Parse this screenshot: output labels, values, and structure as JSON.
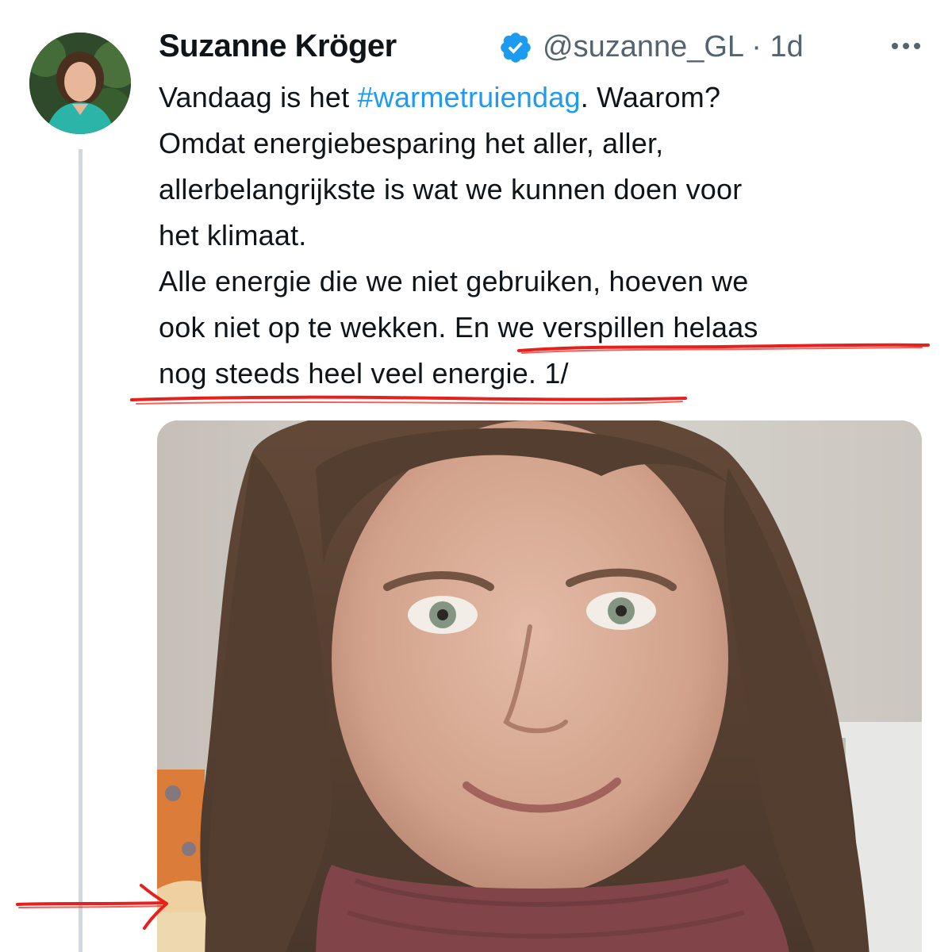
{
  "tweet": {
    "author": {
      "display_name": "Suzanne Kröger",
      "handle": "@suzanne_GL",
      "separator": " · ",
      "time": "1d",
      "verified": true,
      "avatar_icon": "profile-photo-avatar"
    },
    "more_icon": "ellipsis-icon",
    "text_lines": [
      {
        "before": "Vandaag is het ",
        "hashtag": "#warmetruiendag",
        "after": ". Waarom?"
      },
      {
        "text": "Omdat energiebesparing het aller, aller,"
      },
      {
        "text": "allerbelangrijkste is wat we kunnen doen voor"
      },
      {
        "text": "het klimaat."
      },
      {
        "text": "Alle energie die we niet gebruiken, hoeven we"
      },
      {
        "text": "ook niet op te wekken. En we verspillen helaas"
      },
      {
        "text": "nog steeds heel veel energie. 1/"
      }
    ],
    "annotations": {
      "underline_color": "#e8201c",
      "arrow_color": "#e8201c"
    },
    "colors": {
      "link": "#1d9bf0",
      "secondary_text": "#536471",
      "thread_line": "#cfd9de",
      "verified": "#1d9bf0"
    }
  }
}
